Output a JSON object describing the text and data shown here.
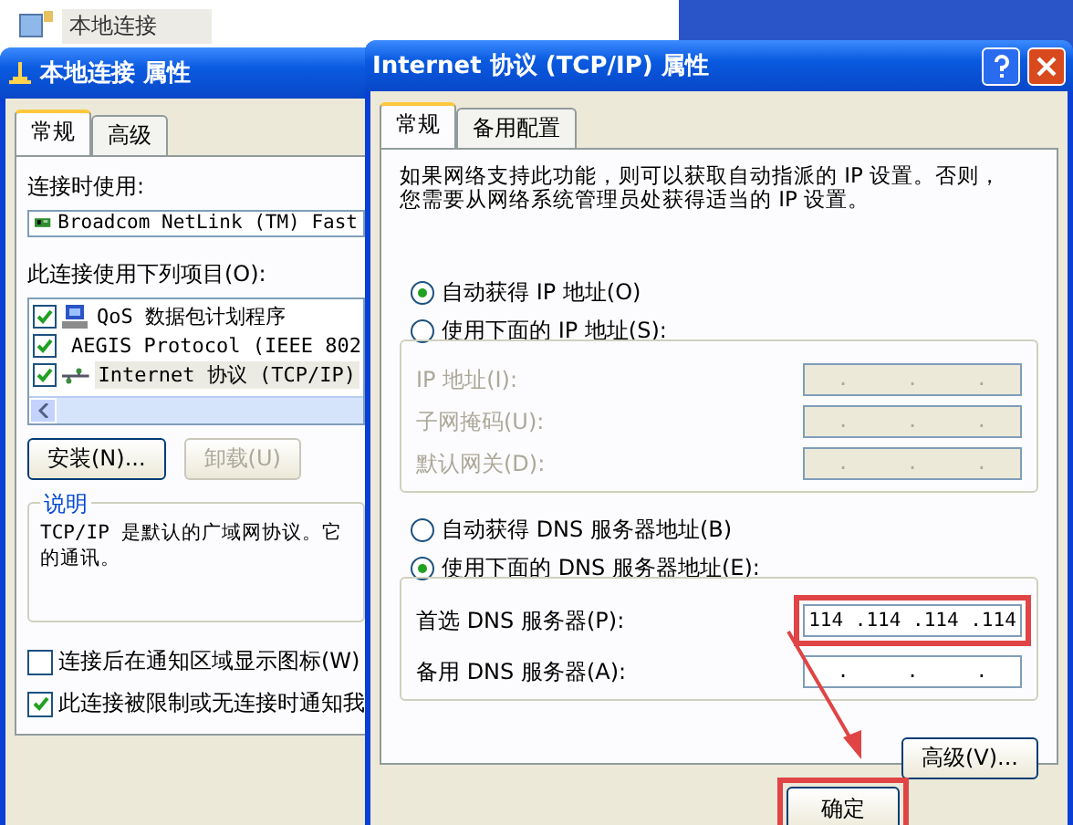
{
  "desktop_icon": {
    "label": "本地连接"
  },
  "left_window": {
    "title": "本地连接 属性",
    "tabs": [
      {
        "label": "常规",
        "selected": true
      },
      {
        "label": "高级",
        "selected": false
      }
    ],
    "connect_label": "连接时使用:",
    "adapter": "Broadcom NetLink (TM) Fast",
    "items_label": "此连接使用下列项目(O):",
    "items": [
      {
        "kind": "service",
        "label": "QoS 数据包计划程序",
        "checked": true,
        "selected": false
      },
      {
        "kind": "protocol",
        "label": "AEGIS Protocol (IEEE 802",
        "checked": true,
        "selected": false
      },
      {
        "kind": "protocol",
        "label": "Internet 协议 (TCP/IP)",
        "checked": true,
        "selected": true
      }
    ],
    "buttons": [
      {
        "label": "安装(N)...",
        "disabled": false
      },
      {
        "label": "卸载(U)",
        "disabled": true
      }
    ],
    "description": {
      "title": "说明",
      "lines": [
        "TCP/IP 是默认的广域网协议。它",
        "的通讯。"
      ]
    },
    "options": [
      {
        "label": "连接后在通知区域显示图标(W)",
        "checked": false
      },
      {
        "label": "此连接被限制或无连接时通知我",
        "checked": true
      }
    ]
  },
  "right_window": {
    "title": "Internet 协议 (TCP/IP) 属性",
    "tabs": [
      {
        "label": "常规",
        "selected": true
      },
      {
        "label": "备用配置",
        "selected": false
      }
    ],
    "intro": [
      "如果网络支持此功能，则可以获取自动指派的 IP 设置。否则，",
      "您需要从网络系统管理员处获得适当的 IP 设置。"
    ],
    "ip_modes": [
      {
        "label": "自动获得 IP 地址(O)",
        "selected": true
      },
      {
        "label": "使用下面的 IP 地址(S):",
        "selected": false
      }
    ],
    "ip_fields": [
      {
        "label": "IP 地址(I):",
        "value": ".     .     .",
        "disabled": true
      },
      {
        "label": "子网掩码(U):",
        "value": ".     .     .",
        "disabled": true
      },
      {
        "label": "默认网关(D):",
        "value": ".     .     .",
        "disabled": true
      }
    ],
    "dns_modes": [
      {
        "label": "自动获得 DNS 服务器地址(B)",
        "selected": false
      },
      {
        "label": "使用下面的 DNS 服务器地址(E):",
        "selected": true
      }
    ],
    "dns_fields": [
      {
        "label": "首选 DNS 服务器(P):",
        "value": "114 .114 .114 .114",
        "disabled": false,
        "highlighted": true
      },
      {
        "label": "备用 DNS 服务器(A):",
        "value": ".     .     .",
        "disabled": false,
        "highlighted": false
      }
    ],
    "advanced_button": "高级(V)...",
    "ok_button": {
      "label": "确定",
      "highlighted": true
    }
  }
}
